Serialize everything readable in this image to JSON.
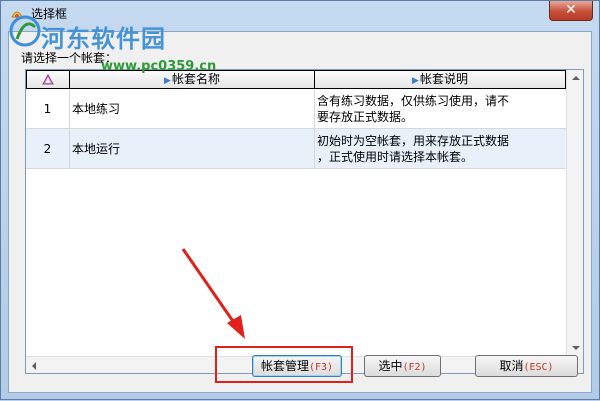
{
  "window": {
    "title": "选择框",
    "close_label": "✕"
  },
  "watermark": {
    "name": "河东软件园",
    "url": "www.pc0359.cn"
  },
  "prompt": "请选择一个帐套：",
  "grid": {
    "index_header_icon": "sort-triangle-icon",
    "header_marker": "▶",
    "columns": [
      "帐套名称",
      "帐套说明"
    ],
    "rows": [
      {
        "index": "1",
        "name": "本地练习",
        "desc_line1": "含有练习数据，仅供练习使用，请不",
        "desc_line2": "要存放正式数据。"
      },
      {
        "index": "2",
        "name": "本地运行",
        "desc_line1": "初始时为空帐套，用来存放正式数据",
        "desc_line2": "，正式使用时请选择本帐套。"
      }
    ]
  },
  "buttons": {
    "manage": {
      "label": "帐套管理",
      "hotkey": "(F3)"
    },
    "select": {
      "label": "选中",
      "hotkey": "(F2)"
    },
    "cancel": {
      "label": "取消",
      "hotkey": "(ESC)"
    }
  },
  "colors": {
    "accent": "#3a7fd0",
    "annotation_red": "#e0201a",
    "selected_row": "#e8f1fa"
  }
}
